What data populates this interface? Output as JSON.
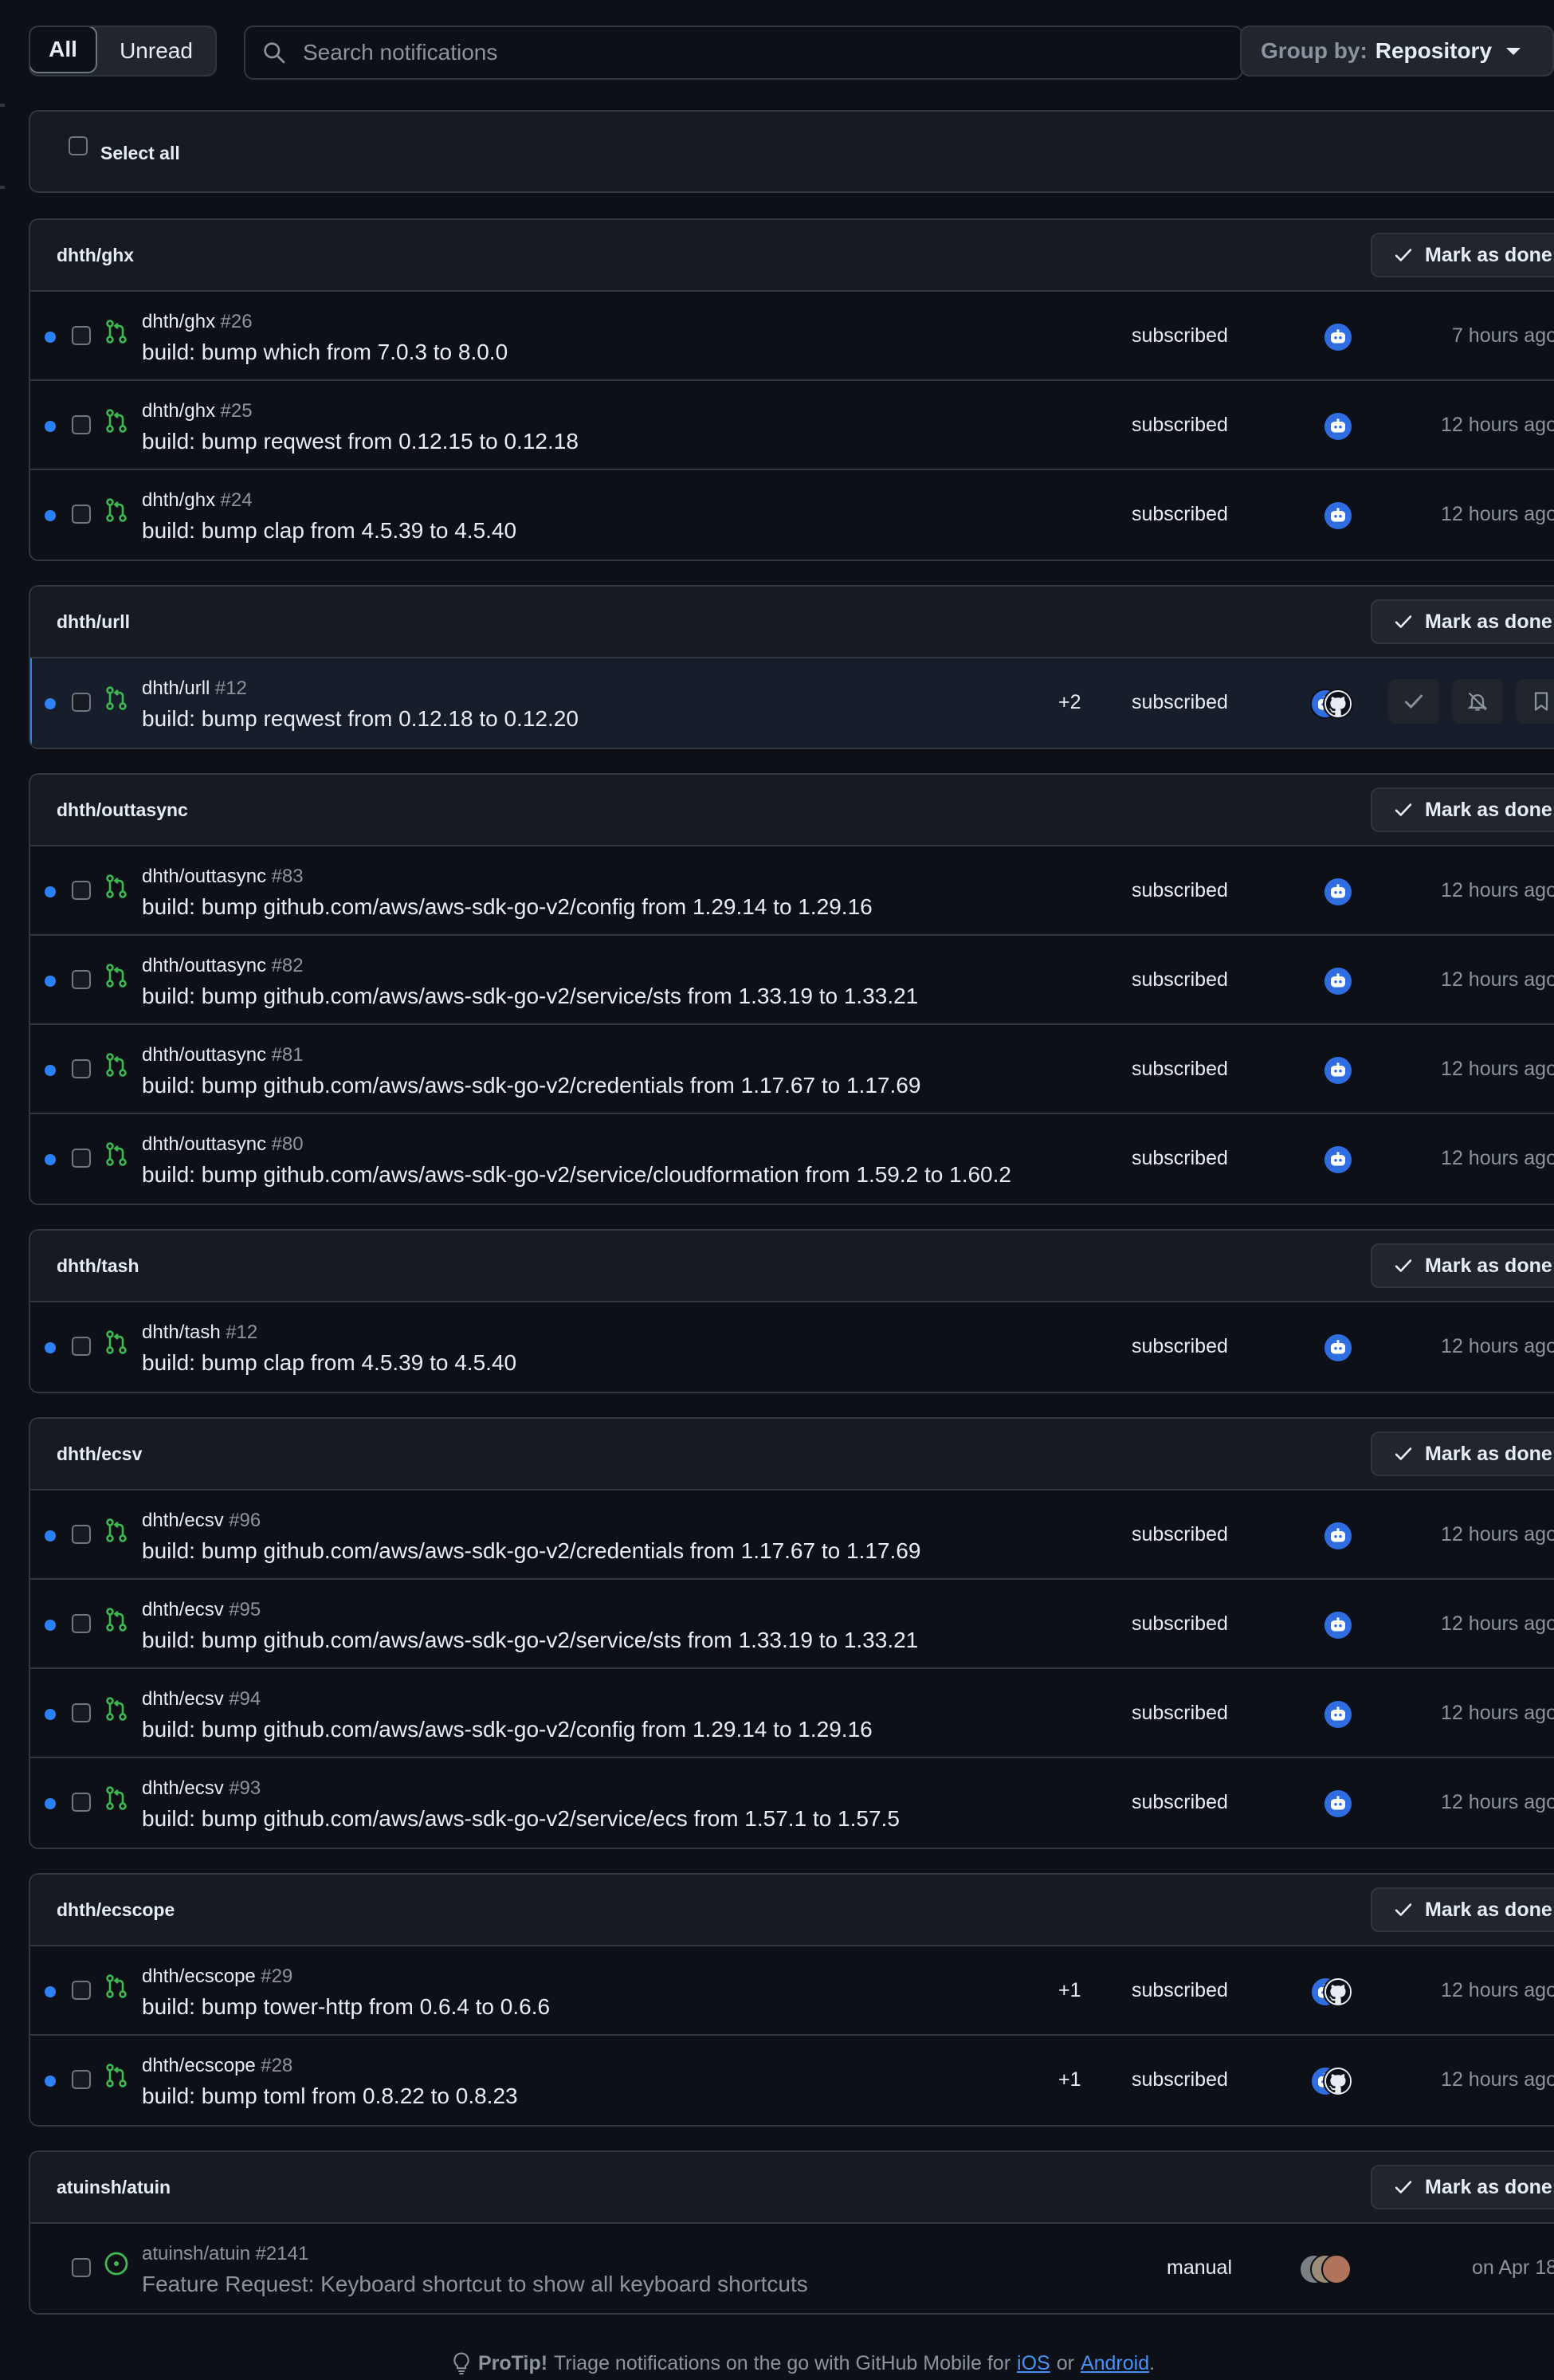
{
  "filter": {
    "all_label": "All",
    "unread_label": "Unread"
  },
  "search": {
    "placeholder": "Search notifications"
  },
  "group_by": {
    "label": "Group by:",
    "value": "Repository"
  },
  "select_all_label": "Select all",
  "mark_done_label": "Mark as done",
  "groups": [
    {
      "name": "dhth/ghx",
      "items": [
        {
          "repo": "dhth/ghx",
          "number": "#26",
          "subject": "build: bump which from 7.0.3 to 8.0.0",
          "reason": "subscribed",
          "time": "7 hours ago",
          "unread": true,
          "type": "pull-request",
          "avatars": [
            "bot"
          ]
        },
        {
          "repo": "dhth/ghx",
          "number": "#25",
          "subject": "build: bump reqwest from 0.12.15 to 0.12.18",
          "reason": "subscribed",
          "time": "12 hours ago",
          "unread": true,
          "type": "pull-request",
          "avatars": [
            "bot"
          ]
        },
        {
          "repo": "dhth/ghx",
          "number": "#24",
          "subject": "build: bump clap from 4.5.39 to 4.5.40",
          "reason": "subscribed",
          "time": "12 hours ago",
          "unread": true,
          "type": "pull-request",
          "avatars": [
            "bot"
          ]
        }
      ]
    },
    {
      "name": "dhth/urll",
      "items": [
        {
          "repo": "dhth/urll",
          "number": "#12",
          "subject": "build: bump reqwest from 0.12.18 to 0.12.20",
          "extra": "+2",
          "reason": "subscribed",
          "time": "",
          "unread": true,
          "type": "pull-request",
          "avatars": [
            "bot",
            "github"
          ],
          "hover": true
        }
      ]
    },
    {
      "name": "dhth/outtasync",
      "items": [
        {
          "repo": "dhth/outtasync",
          "number": "#83",
          "subject": "build: bump github.com/aws/aws-sdk-go-v2/config from 1.29.14 to 1.29.16",
          "reason": "subscribed",
          "time": "12 hours ago",
          "unread": true,
          "type": "pull-request",
          "avatars": [
            "bot"
          ]
        },
        {
          "repo": "dhth/outtasync",
          "number": "#82",
          "subject": "build: bump github.com/aws/aws-sdk-go-v2/service/sts from 1.33.19 to 1.33.21",
          "reason": "subscribed",
          "time": "12 hours ago",
          "unread": true,
          "type": "pull-request",
          "avatars": [
            "bot"
          ]
        },
        {
          "repo": "dhth/outtasync",
          "number": "#81",
          "subject": "build: bump github.com/aws/aws-sdk-go-v2/credentials from 1.17.67 to 1.17.69",
          "reason": "subscribed",
          "time": "12 hours ago",
          "unread": true,
          "type": "pull-request",
          "avatars": [
            "bot"
          ]
        },
        {
          "repo": "dhth/outtasync",
          "number": "#80",
          "subject": "build: bump github.com/aws/aws-sdk-go-v2/service/cloudformation from 1.59.2 to 1.60.2",
          "reason": "subscribed",
          "time": "12 hours ago",
          "unread": true,
          "type": "pull-request",
          "avatars": [
            "bot"
          ]
        }
      ]
    },
    {
      "name": "dhth/tash",
      "items": [
        {
          "repo": "dhth/tash",
          "number": "#12",
          "subject": "build: bump clap from 4.5.39 to 4.5.40",
          "reason": "subscribed",
          "time": "12 hours ago",
          "unread": true,
          "type": "pull-request",
          "avatars": [
            "bot"
          ]
        }
      ]
    },
    {
      "name": "dhth/ecsv",
      "items": [
        {
          "repo": "dhth/ecsv",
          "number": "#96",
          "subject": "build: bump github.com/aws/aws-sdk-go-v2/credentials from 1.17.67 to 1.17.69",
          "reason": "subscribed",
          "time": "12 hours ago",
          "unread": true,
          "type": "pull-request",
          "avatars": [
            "bot"
          ]
        },
        {
          "repo": "dhth/ecsv",
          "number": "#95",
          "subject": "build: bump github.com/aws/aws-sdk-go-v2/service/sts from 1.33.19 to 1.33.21",
          "reason": "subscribed",
          "time": "12 hours ago",
          "unread": true,
          "type": "pull-request",
          "avatars": [
            "bot"
          ]
        },
        {
          "repo": "dhth/ecsv",
          "number": "#94",
          "subject": "build: bump github.com/aws/aws-sdk-go-v2/config from 1.29.14 to 1.29.16",
          "reason": "subscribed",
          "time": "12 hours ago",
          "unread": true,
          "type": "pull-request",
          "avatars": [
            "bot"
          ]
        },
        {
          "repo": "dhth/ecsv",
          "number": "#93",
          "subject": "build: bump github.com/aws/aws-sdk-go-v2/service/ecs from 1.57.1 to 1.57.5",
          "reason": "subscribed",
          "time": "12 hours ago",
          "unread": true,
          "type": "pull-request",
          "avatars": [
            "bot"
          ]
        }
      ]
    },
    {
      "name": "dhth/ecscope",
      "items": [
        {
          "repo": "dhth/ecscope",
          "number": "#29",
          "subject": "build: bump tower-http from 0.6.4 to 0.6.6",
          "extra": "+1",
          "reason": "subscribed",
          "time": "12 hours ago",
          "unread": true,
          "type": "pull-request",
          "avatars": [
            "bot",
            "github"
          ]
        },
        {
          "repo": "dhth/ecscope",
          "number": "#28",
          "subject": "build: bump toml from 0.8.22 to 0.8.23",
          "extra": "+1",
          "reason": "subscribed",
          "time": "12 hours ago",
          "unread": true,
          "type": "pull-request",
          "avatars": [
            "bot",
            "github"
          ]
        }
      ]
    },
    {
      "name": "atuinsh/atuin",
      "items": [
        {
          "repo": "atuinsh/atuin",
          "number": "#2141",
          "subject": "Feature Request: Keyboard shortcut to show all keyboard shortcuts",
          "reason": "manual",
          "time": "on Apr 18",
          "unread": false,
          "type": "issue",
          "avatars": [
            "person-1",
            "person-2",
            "person-3"
          ]
        }
      ]
    }
  ],
  "protip": {
    "bold": "ProTip!",
    "text": "Triage notifications on the go with GitHub Mobile for",
    "ios_link": "iOS",
    "or": "or",
    "android_link": "Android",
    "end": "."
  },
  "colors": {
    "accent": "#2f81f7",
    "pr_open": "#3fb950",
    "background": "#0d1117"
  }
}
